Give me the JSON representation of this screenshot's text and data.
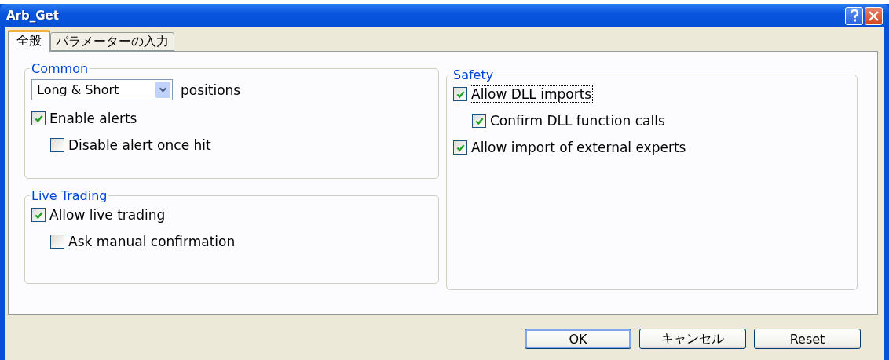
{
  "window": {
    "title": "Arb_Get"
  },
  "tabs": [
    {
      "label": "全般",
      "selected": true
    },
    {
      "label": "パラメーターの入力",
      "selected": false
    }
  ],
  "common": {
    "title": "Common",
    "dropdown": {
      "value": "Long & Short"
    },
    "dropdown_suffix": "positions",
    "options": [
      {
        "label": "Enable alerts",
        "checked": true,
        "children": [
          {
            "label": "Disable alert once hit",
            "checked": false
          }
        ]
      }
    ]
  },
  "live_trading": {
    "title": "Live Trading",
    "options": [
      {
        "label": "Allow live trading",
        "checked": true,
        "children": [
          {
            "label": "Ask manual confirmation",
            "checked": false
          }
        ]
      }
    ]
  },
  "safety": {
    "title": "Safety",
    "options": [
      {
        "label": "Allow DLL imports",
        "checked": true,
        "focused": true,
        "children": [
          {
            "label": "Confirm DLL function calls",
            "checked": true
          }
        ]
      },
      {
        "label": "Allow import of external experts",
        "checked": true
      }
    ]
  },
  "buttons": [
    {
      "label": "OK",
      "default": true
    },
    {
      "label": "キャンセル",
      "default": false
    },
    {
      "label": "Reset",
      "default": false
    }
  ]
}
